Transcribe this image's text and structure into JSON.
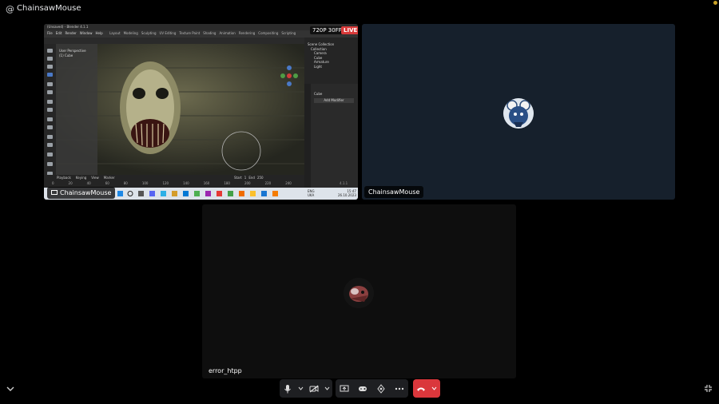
{
  "header": {
    "at_symbol": "@",
    "title": "ChainsawMouse"
  },
  "stream": {
    "streamer_name": "ChainsawMouse",
    "quality": "720P 30FPS",
    "live_label": "LIVE",
    "blender": {
      "window_title": "(Unsaved) - Blender 4.1.1",
      "menu": [
        "File",
        "Edit",
        "Render",
        "Window",
        "Help"
      ],
      "workspaces": [
        "Layout",
        "Modeling",
        "Sculpting",
        "UV Editing",
        "Texture Paint",
        "Shading",
        "Animation",
        "Rendering",
        "Compositing",
        "Scripting"
      ],
      "viewport_info": [
        "User Perspective",
        "(1) Cube"
      ],
      "outliner_items": [
        "Scene Collection",
        "Collection",
        "Camera",
        "Cube",
        "Armature",
        "Light"
      ],
      "props_object": "Cube",
      "props_button": "Add Modifier",
      "timeline_labels": [
        "Playback",
        "Keying",
        "View",
        "Marker"
      ],
      "frame_start_label": "Start",
      "frame_start": "1",
      "frame_end_label": "End",
      "frame_end": "250",
      "tick_labels": [
        "0",
        "20",
        "40",
        "60",
        "80",
        "100",
        "120",
        "140",
        "160",
        "180",
        "200",
        "220",
        "240"
      ],
      "taskbar_lang": [
        "ENG",
        "UKA"
      ],
      "taskbar_time": "15:47",
      "taskbar_date": "26.10.2023",
      "version": "4.1.1"
    }
  },
  "participants": [
    {
      "name": "ChainsawMouse"
    },
    {
      "name": "error_htpp"
    }
  ],
  "colors": {
    "hangup": "#da373c",
    "live": "#d83a3a",
    "notification": "#c9a227"
  },
  "controls": [
    "mic",
    "mic-options",
    "camera-off",
    "camera-options",
    "screen-share",
    "activities",
    "soundboard",
    "more",
    "disconnect",
    "disconnect-options"
  ]
}
